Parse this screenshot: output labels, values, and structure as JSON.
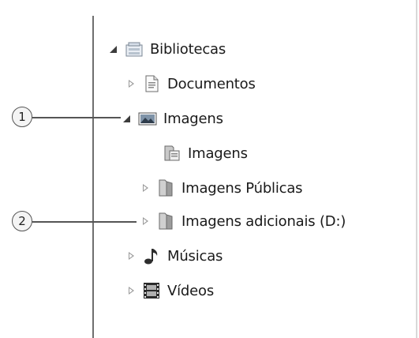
{
  "tree": {
    "items": [
      {
        "label": "Bibliotecas",
        "arrow": "expanded",
        "icon": "library-icon"
      },
      {
        "label": "Documentos",
        "arrow": "collapsed",
        "icon": "document-icon"
      },
      {
        "label": "Imagens",
        "arrow": "expanded",
        "icon": "pictures-icon"
      },
      {
        "label": "Imagens",
        "arrow": "none",
        "icon": "folder-library-icon"
      },
      {
        "label": "Imagens Públicas",
        "arrow": "collapsed",
        "icon": "folder-icon"
      },
      {
        "label": "Imagens adicionais (D:)",
        "arrow": "collapsed",
        "icon": "folder-icon"
      },
      {
        "label": "Músicas",
        "arrow": "collapsed",
        "icon": "music-icon"
      },
      {
        "label": "Vídeos",
        "arrow": "collapsed",
        "icon": "video-icon"
      }
    ]
  },
  "callouts": [
    {
      "number": "1"
    },
    {
      "number": "2"
    }
  ]
}
